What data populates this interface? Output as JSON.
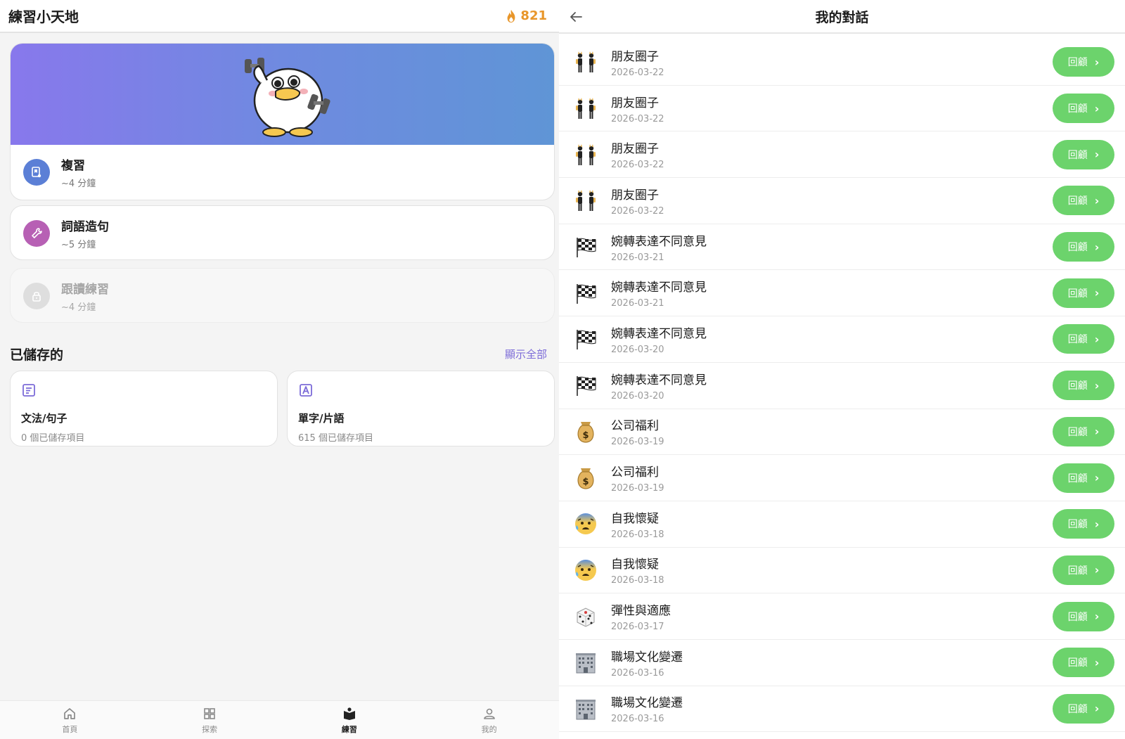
{
  "left": {
    "title": "練習小天地",
    "streak": "821",
    "tasks": [
      {
        "title": "複習",
        "duration": "~4 分鐘",
        "icon": "flashcard-icon",
        "color": "#5b7fd6",
        "locked": false
      },
      {
        "title": "詞語造句",
        "duration": "~5 分鐘",
        "icon": "wrench-icon",
        "color": "#b760b4",
        "locked": false
      },
      {
        "title": "跟讀練習",
        "duration": "~4 分鐘",
        "icon": "lock-icon",
        "color": "#dedede",
        "locked": true
      }
    ],
    "saved": {
      "title": "已儲存的",
      "show_all": "顯示全部",
      "cards": [
        {
          "title": "文法/句子",
          "subtitle": "0 個已儲存項目",
          "icon": "grammar-icon"
        },
        {
          "title": "單字/片語",
          "subtitle": "615 個已儲存項目",
          "icon": "vocabulary-icon"
        }
      ]
    },
    "nav": [
      {
        "label": "首頁",
        "icon": "home-icon",
        "active": false
      },
      {
        "label": "探索",
        "icon": "grid-icon",
        "active": false
      },
      {
        "label": "練習",
        "icon": "practice-book-icon",
        "active": true
      },
      {
        "label": "我的",
        "icon": "profile-icon",
        "active": false
      }
    ]
  },
  "right": {
    "title": "我的對話",
    "review_label": "回顧",
    "conversations": [
      {
        "title": "朋友圈子",
        "date": "2026-03-22",
        "icon": "dancers-icon"
      },
      {
        "title": "朋友圈子",
        "date": "2026-03-22",
        "icon": "dancers-icon"
      },
      {
        "title": "朋友圈子",
        "date": "2026-03-22",
        "icon": "dancers-icon"
      },
      {
        "title": "朋友圈子",
        "date": "2026-03-22",
        "icon": "dancers-icon"
      },
      {
        "title": "婉轉表達不同意見",
        "date": "2026-03-21",
        "icon": "checkered-flag-icon"
      },
      {
        "title": "婉轉表達不同意見",
        "date": "2026-03-21",
        "icon": "checkered-flag-icon"
      },
      {
        "title": "婉轉表達不同意見",
        "date": "2026-03-20",
        "icon": "checkered-flag-icon"
      },
      {
        "title": "婉轉表達不同意見",
        "date": "2026-03-20",
        "icon": "checkered-flag-icon"
      },
      {
        "title": "公司福利",
        "date": "2026-03-19",
        "icon": "money-bag-icon"
      },
      {
        "title": "公司福利",
        "date": "2026-03-19",
        "icon": "money-bag-icon"
      },
      {
        "title": "自我懷疑",
        "date": "2026-03-18",
        "icon": "anxious-face-icon"
      },
      {
        "title": "自我懷疑",
        "date": "2026-03-18",
        "icon": "anxious-face-icon"
      },
      {
        "title": "彈性與適應",
        "date": "2026-03-17",
        "icon": "dice-icon"
      },
      {
        "title": "職場文化變遷",
        "date": "2026-03-16",
        "icon": "office-building-icon"
      },
      {
        "title": "職場文化變遷",
        "date": "2026-03-16",
        "icon": "office-building-icon"
      }
    ]
  }
}
